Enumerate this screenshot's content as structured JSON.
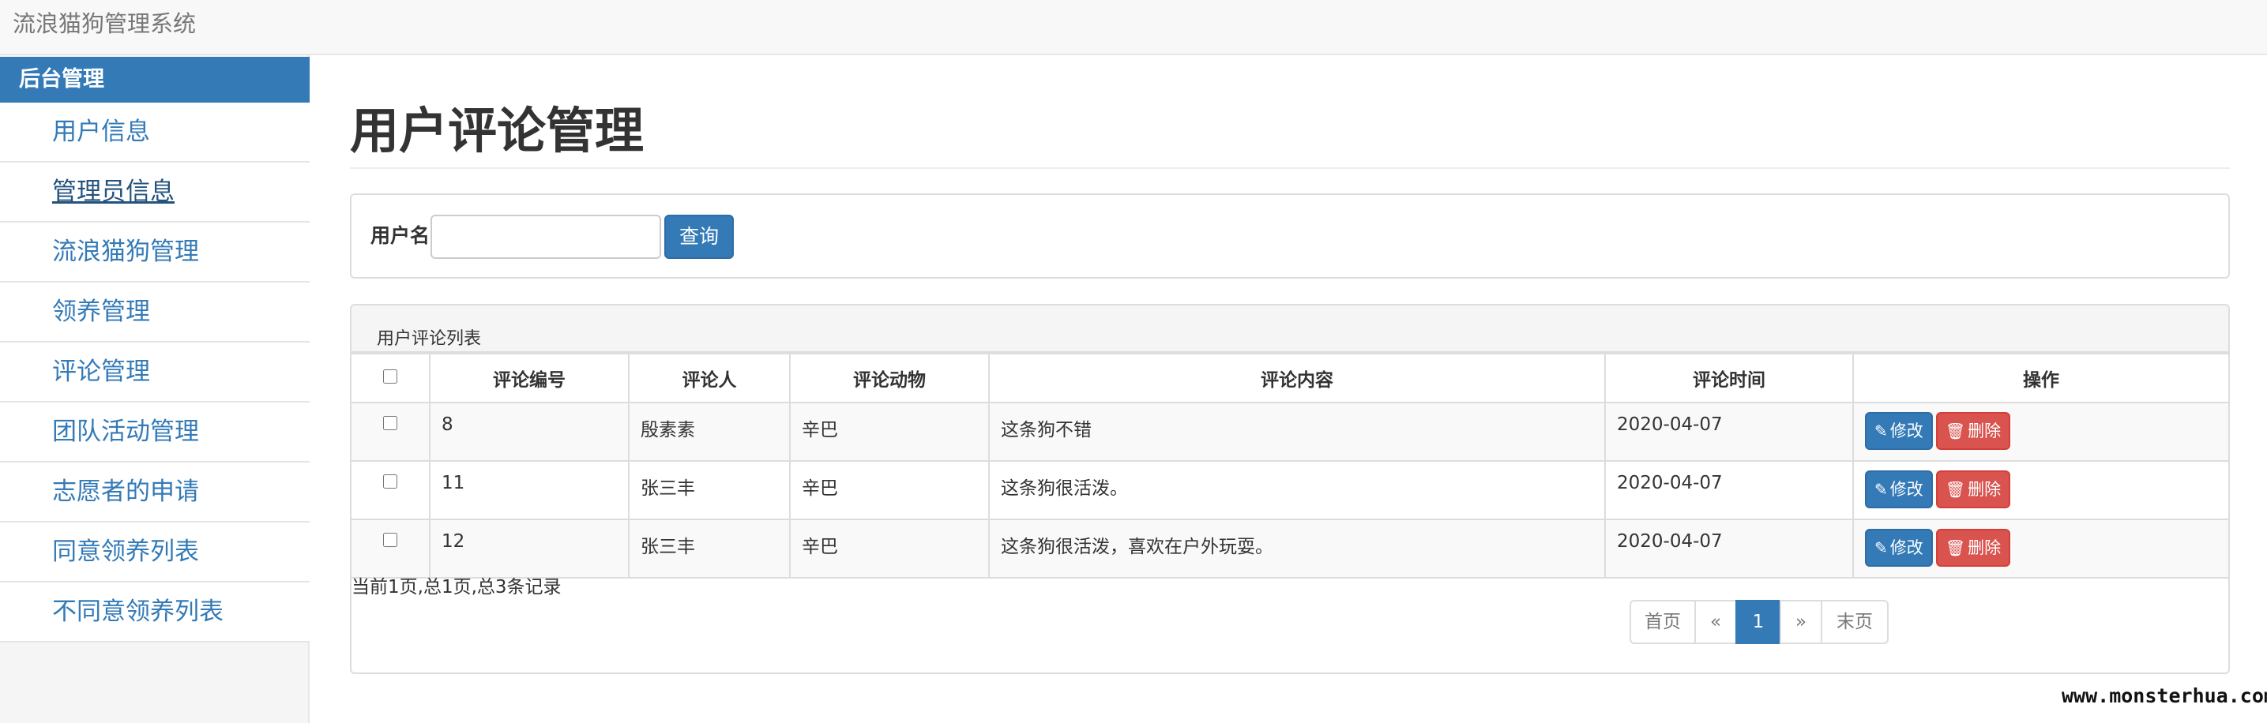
{
  "app": {
    "brand": "流浪猫狗管理系统"
  },
  "sidebar": {
    "heading": "后台管理",
    "items": [
      {
        "label": "用户信息"
      },
      {
        "label": "管理员信息"
      },
      {
        "label": "流浪猫狗管理"
      },
      {
        "label": "领养管理"
      },
      {
        "label": "评论管理"
      },
      {
        "label": "团队活动管理"
      },
      {
        "label": "志愿者的申请"
      },
      {
        "label": "同意领养列表"
      },
      {
        "label": "不同意领养列表"
      }
    ]
  },
  "main": {
    "title": "用户评论管理",
    "search": {
      "label": "用户名",
      "value": "",
      "button": "查询"
    },
    "panel_title": "用户评论列表",
    "table": {
      "headers": [
        "评论编号",
        "评论人",
        "评论动物",
        "评论内容",
        "评论时间",
        "操作"
      ],
      "rows": [
        {
          "id": "8",
          "user": "殷素素",
          "animal": "辛巴",
          "content": "这条狗不错",
          "time": "2020-04-07"
        },
        {
          "id": "11",
          "user": "张三丰",
          "animal": "辛巴",
          "content": "这条狗很活泼。",
          "time": "2020-04-07"
        },
        {
          "id": "12",
          "user": "张三丰",
          "animal": "辛巴",
          "content": "这条狗很活泼，喜欢在户外玩耍。",
          "time": "2020-04-07"
        }
      ],
      "edit_label": "修改",
      "delete_label": "删除",
      "edit_icon": "pencil-icon",
      "delete_icon": "trash-icon"
    },
    "records_text": "当前1页,总1页,总3条记录",
    "pagination": {
      "first": "首页",
      "prev": "«",
      "current": "1",
      "next": "»",
      "last": "末页"
    }
  },
  "watermark": "www.monsterhua.com",
  "colors": {
    "primary": "#337ab7",
    "danger": "#d9534f",
    "navbar": "#f8f8f8"
  }
}
